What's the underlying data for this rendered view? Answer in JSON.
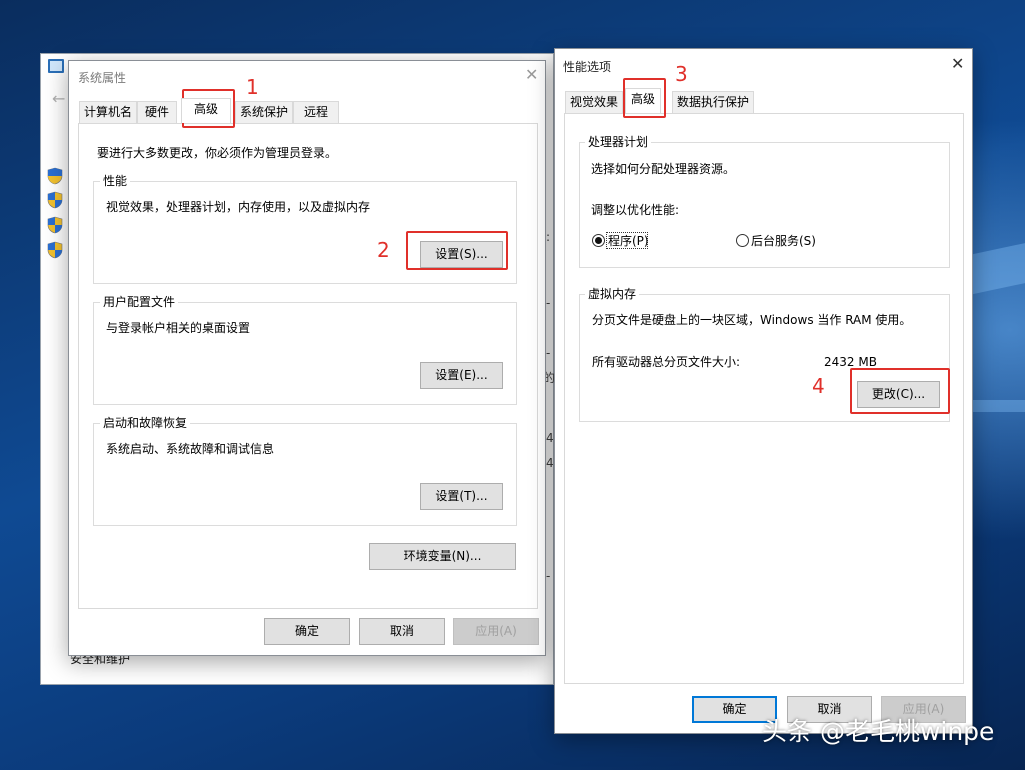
{
  "background_window": {
    "footer_text": "安全和维护",
    "edge_fragments": [
      ":",
      "-",
      "-",
      "的",
      "4",
      "4",
      "-"
    ]
  },
  "system_properties": {
    "title": "系统属性",
    "tabs": [
      {
        "label": "计算机名"
      },
      {
        "label": "硬件"
      },
      {
        "label": "高级"
      },
      {
        "label": "系统保护"
      },
      {
        "label": "远程"
      }
    ],
    "admin_note": "要进行大多数更改，你必须作为管理员登录。",
    "performance": {
      "title": "性能",
      "description": "视觉效果，处理器计划，内存使用，以及虚拟内存",
      "settings_label": "设置(S)..."
    },
    "user_profiles": {
      "title": "用户配置文件",
      "description": "与登录帐户相关的桌面设置",
      "settings_label": "设置(E)..."
    },
    "startup_recovery": {
      "title": "启动和故障恢复",
      "description": "系统启动、系统故障和调试信息",
      "settings_label": "设置(T)..."
    },
    "env_vars_label": "环境变量(N)...",
    "ok_label": "确定",
    "cancel_label": "取消",
    "apply_label": "应用(A)"
  },
  "performance_options": {
    "title": "性能选项",
    "tabs": [
      {
        "label": "视觉效果"
      },
      {
        "label": "高级"
      },
      {
        "label": "数据执行保护"
      }
    ],
    "processor_scheduling": {
      "title": "处理器计划",
      "description": "选择如何分配处理器资源。",
      "adjust_label": "调整以优化性能:",
      "options": [
        {
          "label": "程序(P)",
          "checked": true
        },
        {
          "label": "后台服务(S)",
          "checked": false
        }
      ]
    },
    "virtual_memory": {
      "title": "虚拟内存",
      "description": "分页文件是硬盘上的一块区域，Windows 当作 RAM 使用。",
      "total_label": "所有驱动器总分页文件大小:",
      "total_value": "2432 MB",
      "change_label": "更改(C)..."
    },
    "ok_label": "确定",
    "cancel_label": "取消",
    "apply_label": "应用(A)"
  },
  "annotations": [
    "1",
    "2",
    "3",
    "4"
  ],
  "watermark": "头条 @老毛桃winpe",
  "colors": {
    "annotation": "#e0302a",
    "accent": "#0078d7"
  }
}
